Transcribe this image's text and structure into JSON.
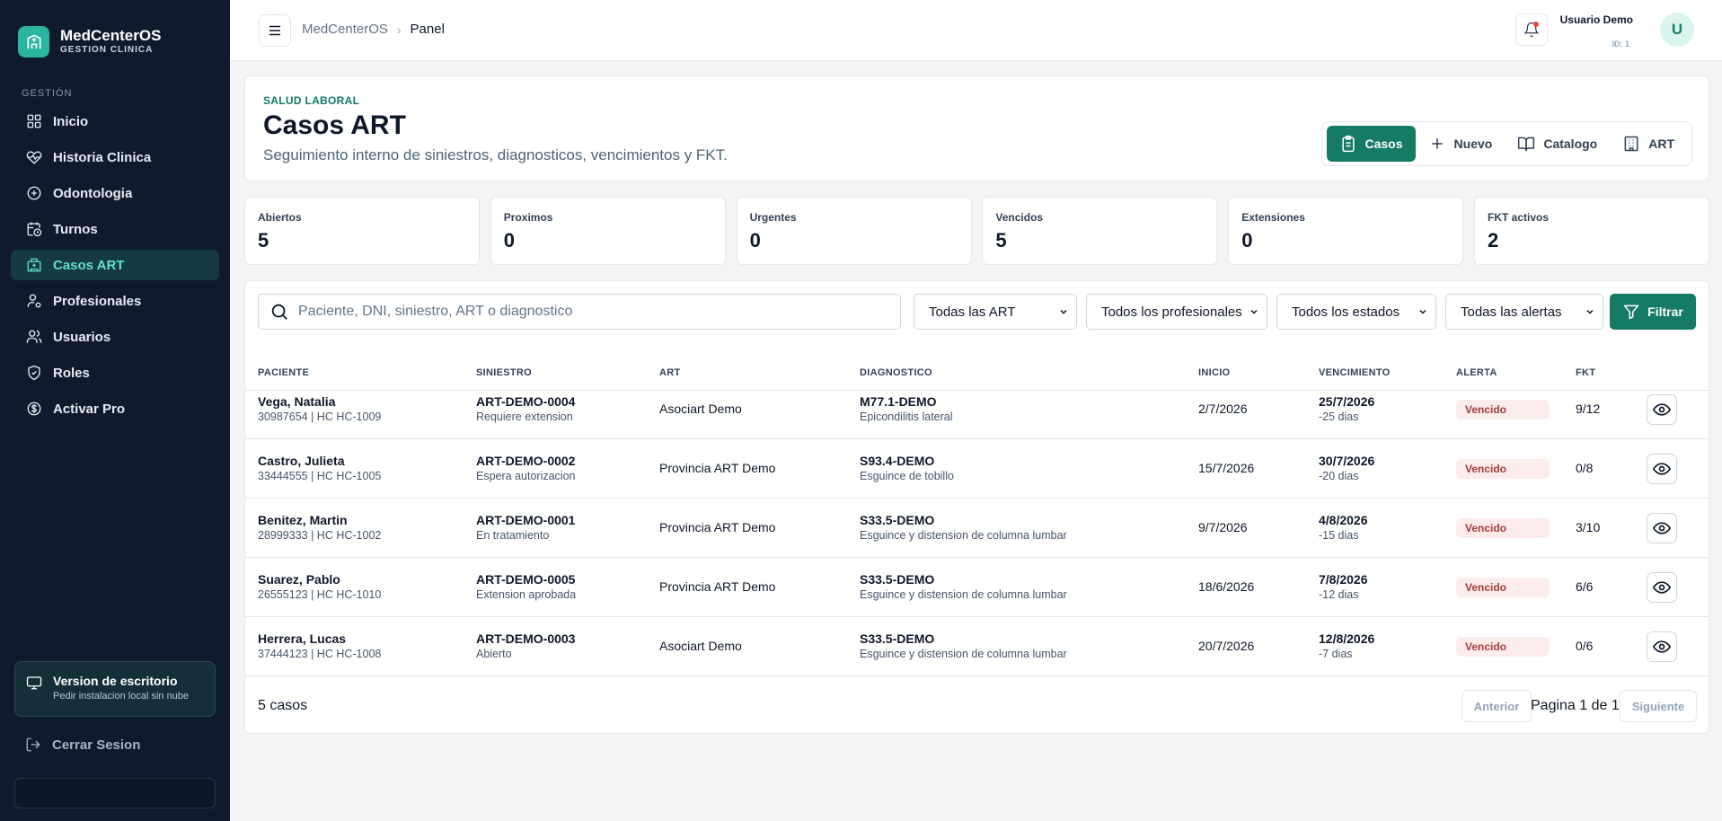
{
  "brand": {
    "name": "MedCenterOS",
    "subtitle": "GESTION CLINICA"
  },
  "sidebar": {
    "section_label": "GESTIÓN",
    "items": [
      {
        "label": "Inicio",
        "icon": "grid-icon"
      },
      {
        "label": "Historia Clinica",
        "icon": "heart-pulse-icon"
      },
      {
        "label": "Odontologia",
        "icon": "plus-circle-icon"
      },
      {
        "label": "Turnos",
        "icon": "calendar-clock-icon"
      },
      {
        "label": "Casos ART",
        "icon": "hospital-icon",
        "active": true
      },
      {
        "label": "Profesionales",
        "icon": "user-cog-icon"
      },
      {
        "label": "Usuarios",
        "icon": "users-icon"
      },
      {
        "label": "Roles",
        "icon": "shield-check-icon"
      },
      {
        "label": "Activar Pro",
        "icon": "dollar-circle-icon"
      }
    ],
    "desktop_card": {
      "title": "Version de escritorio",
      "subtitle": "Pedir instalacion local sin nube"
    },
    "logout_label": "Cerrar Sesion"
  },
  "topbar": {
    "breadcrumb_root": "MedCenterOS",
    "breadcrumb_current": "Panel",
    "user_name": "Usuario Demo",
    "user_id": "ID: 1",
    "avatar_initial": "U"
  },
  "header": {
    "eyebrow": "SALUD LABORAL",
    "title": "Casos ART",
    "subtitle": "Seguimiento interno de siniestros, diagnosticos, vencimientos y FKT.",
    "tabs": [
      {
        "label": "Casos",
        "icon": "clipboard-icon",
        "active": true
      },
      {
        "label": "Nuevo",
        "icon": "plus-icon"
      },
      {
        "label": "Catalogo",
        "icon": "book-open-icon"
      },
      {
        "label": "ART",
        "icon": "building-icon"
      }
    ]
  },
  "stats": [
    {
      "label": "Abiertos",
      "value": "5"
    },
    {
      "label": "Proximos",
      "value": "0"
    },
    {
      "label": "Urgentes",
      "value": "0"
    },
    {
      "label": "Vencidos",
      "value": "5"
    },
    {
      "label": "Extensiones",
      "value": "0"
    },
    {
      "label": "FKT activos",
      "value": "2"
    }
  ],
  "filters": {
    "search_placeholder": "Paciente, DNI, siniestro, ART o diagnostico",
    "art": "Todas las ART",
    "profesional": "Todos los profesionales",
    "estado": "Todos los estados",
    "alerta": "Todas las alertas",
    "button": "Filtrar"
  },
  "table": {
    "headers": [
      "PACIENTE",
      "SINIESTRO",
      "ART",
      "DIAGNOSTICO",
      "INICIO",
      "VENCIMIENTO",
      "ALERTA",
      "FKT"
    ],
    "rows": [
      {
        "paciente": "Vega, Natalia",
        "paciente_sub": "30987654 | HC HC-1009",
        "siniestro": "ART-DEMO-0004",
        "siniestro_sub": "Requiere extension",
        "art": "Asociart Demo",
        "diag": "M77.1-DEMO",
        "diag_sub": "Epicondilitis lateral",
        "inicio": "2/7/2026",
        "venc": "25/7/2026",
        "venc_sub": "-25 dias",
        "alerta": "Vencido",
        "fkt": "9/12"
      },
      {
        "paciente": "Castro, Julieta",
        "paciente_sub": "33444555 | HC HC-1005",
        "siniestro": "ART-DEMO-0002",
        "siniestro_sub": "Espera autorizacion",
        "art": "Provincia ART Demo",
        "diag": "S93.4-DEMO",
        "diag_sub": "Esguince de tobillo",
        "inicio": "15/7/2026",
        "venc": "30/7/2026",
        "venc_sub": "-20 dias",
        "alerta": "Vencido",
        "fkt": "0/8"
      },
      {
        "paciente": "Benitez, Martin",
        "paciente_sub": "28999333 | HC HC-1002",
        "siniestro": "ART-DEMO-0001",
        "siniestro_sub": "En tratamiento",
        "art": "Provincia ART Demo",
        "diag": "S33.5-DEMO",
        "diag_sub": "Esguince y distension de columna lumbar",
        "inicio": "9/7/2026",
        "venc": "4/8/2026",
        "venc_sub": "-15 dias",
        "alerta": "Vencido",
        "fkt": "3/10"
      },
      {
        "paciente": "Suarez, Pablo",
        "paciente_sub": "26555123 | HC HC-1010",
        "siniestro": "ART-DEMO-0005",
        "siniestro_sub": "Extension aprobada",
        "art": "Provincia ART Demo",
        "diag": "S33.5-DEMO",
        "diag_sub": "Esguince y distension de columna lumbar",
        "inicio": "18/6/2026",
        "venc": "7/8/2026",
        "venc_sub": "-12 dias",
        "alerta": "Vencido",
        "fkt": "6/6"
      },
      {
        "paciente": "Herrera, Lucas",
        "paciente_sub": "37444123 | HC HC-1008",
        "siniestro": "ART-DEMO-0003",
        "siniestro_sub": "Abierto",
        "art": "Asociart Demo",
        "diag": "S33.5-DEMO",
        "diag_sub": "Esguince y distension de columna lumbar",
        "inicio": "20/7/2026",
        "venc": "12/8/2026",
        "venc_sub": "-7 dias",
        "alerta": "Vencido",
        "fkt": "0/6"
      }
    ]
  },
  "footer": {
    "count": "5 casos",
    "prev": "Anterior",
    "page": "Pagina 1 de 1",
    "next": "Siguiente"
  },
  "colors": {
    "accent": "#157a66",
    "sidebar_bg": "#0f1b2d",
    "active_text": "#5ee3c9",
    "alert_bg": "#fdecec"
  }
}
